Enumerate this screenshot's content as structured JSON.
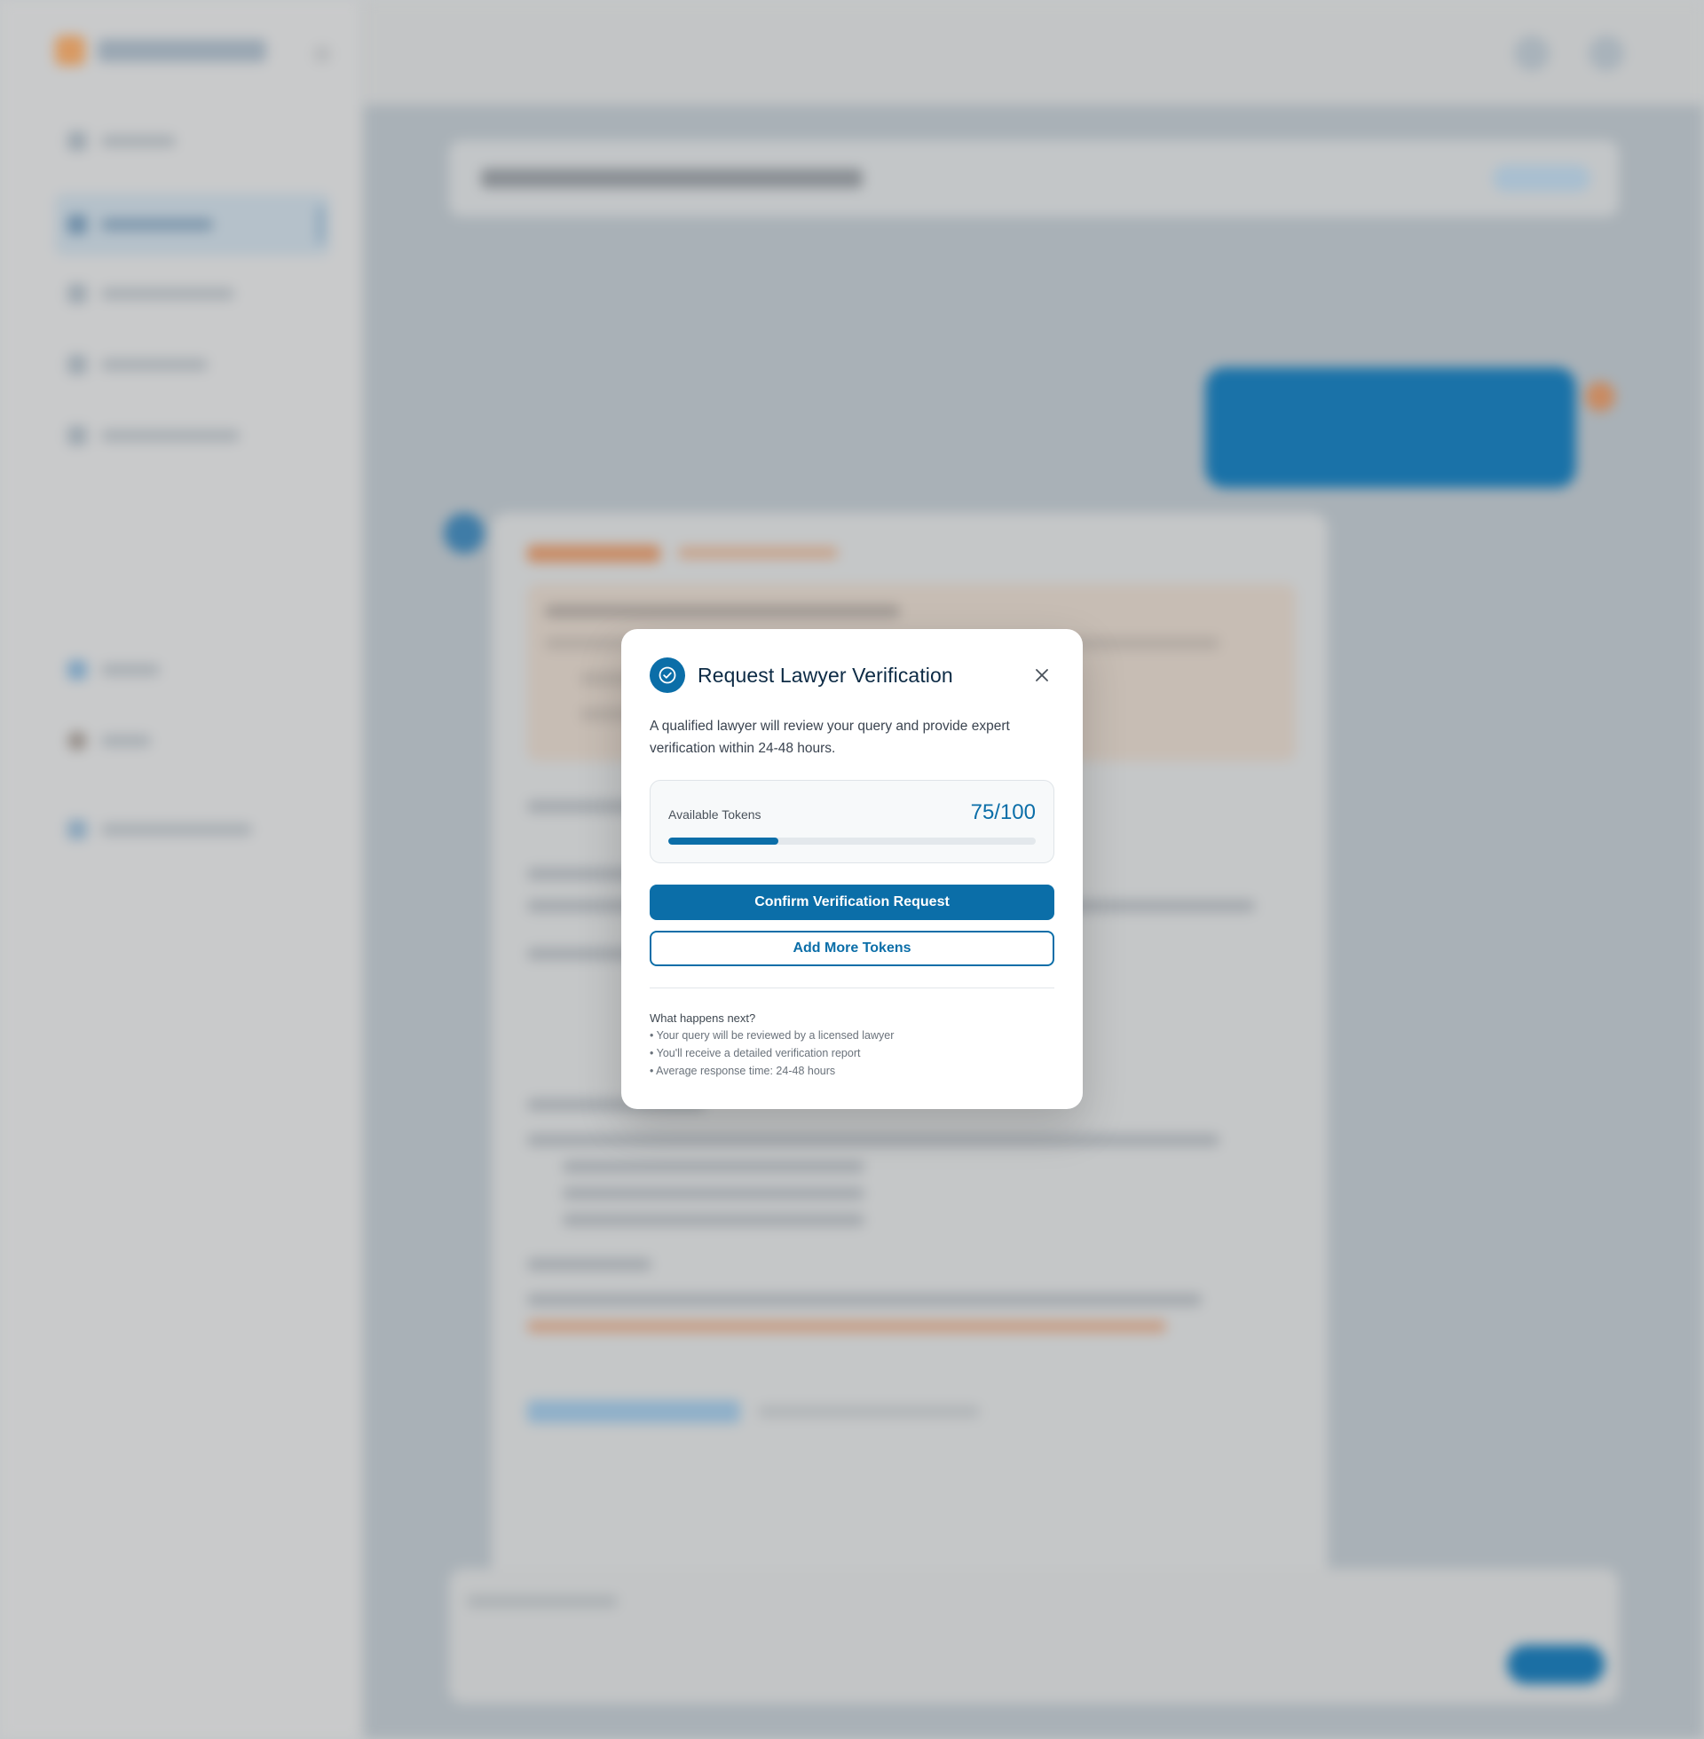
{
  "modal": {
    "title": "Request Lawyer Verification",
    "description": "A qualified lawyer will review your query and provide expert verification within 24-48 hours.",
    "tokens": {
      "label": "Available Tokens",
      "value_text": "75/100",
      "progress_fraction": 0.3
    },
    "confirm_label": "Confirm Verification Request",
    "add_tokens_label": "Add More Tokens",
    "next_title": "What happens next?",
    "next_items": [
      "• Your query will be reviewed by a licensed lawyer",
      "• You'll receive a detailed verification report",
      "• Average response time: 24-48 hours"
    ]
  },
  "colors": {
    "primary": "#0b6ea8",
    "title": "#0d2b45",
    "overlay": "#c4c7c9"
  },
  "icons": {
    "badge": "check-circle-icon",
    "close": "close-icon"
  }
}
